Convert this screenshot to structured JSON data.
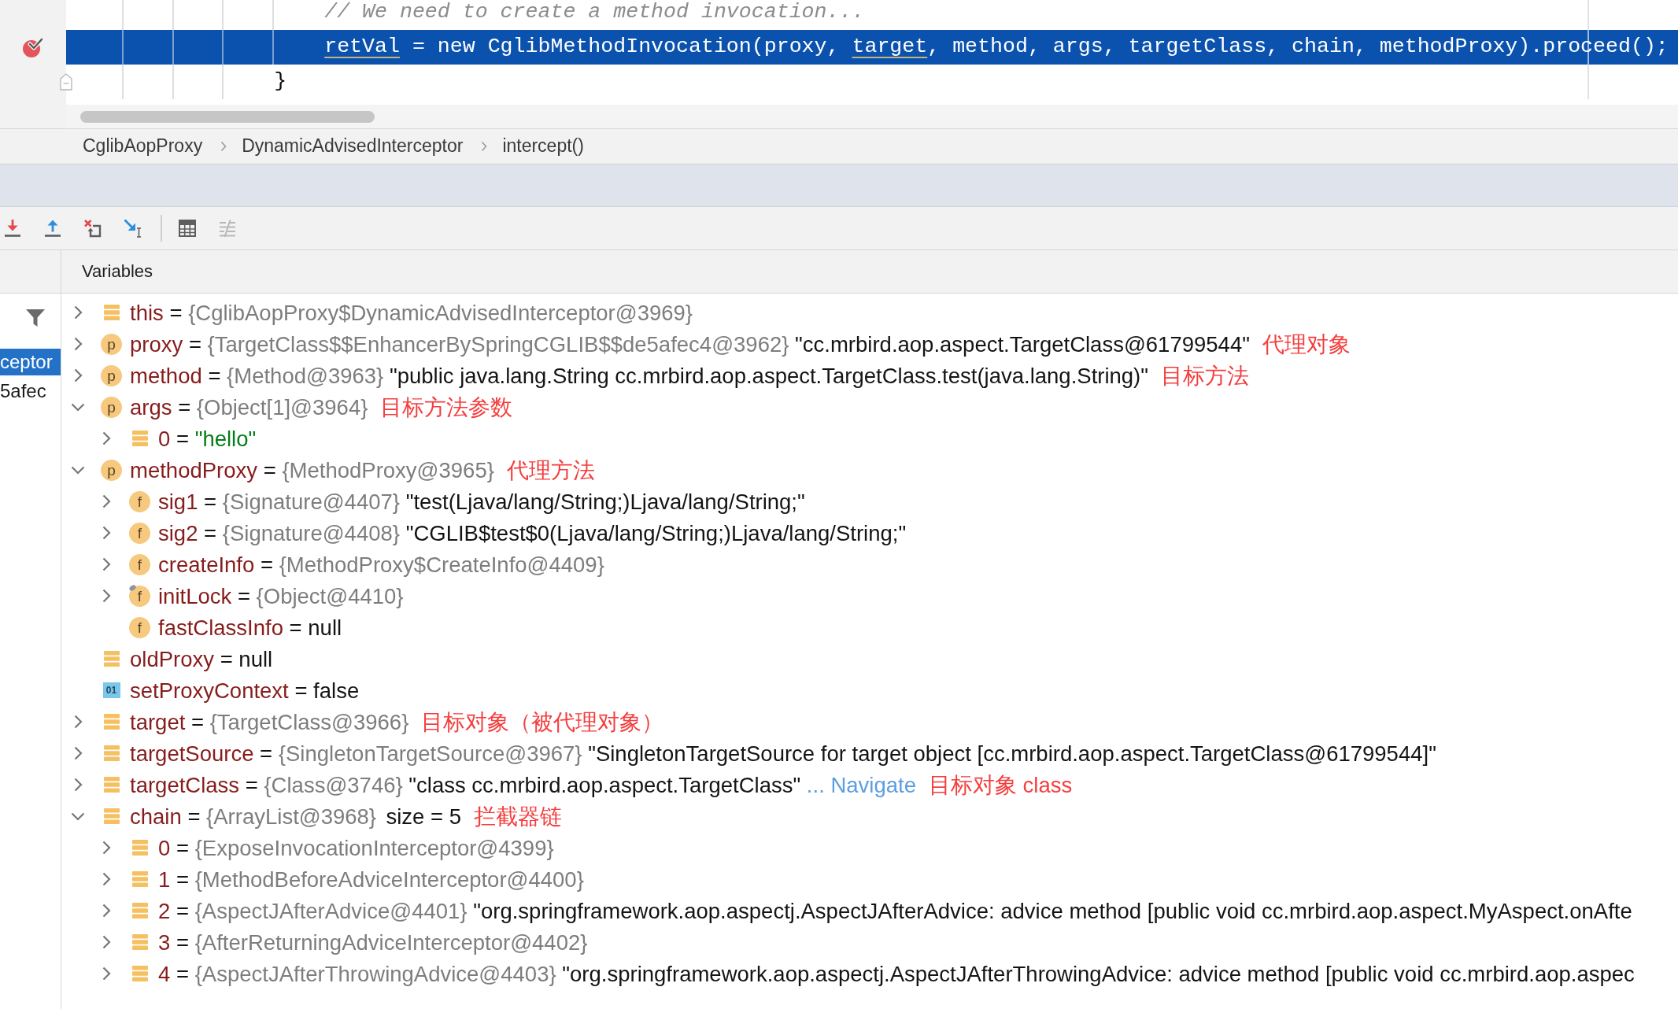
{
  "editor": {
    "lines": [
      {
        "kind": "comment",
        "highlighted": false,
        "breakpoint": false,
        "fold": false,
        "tokens": [
          {
            "text": "                    // We need to create a method invocation...",
            "underlined": false
          }
        ]
      },
      {
        "kind": "code",
        "highlighted": true,
        "breakpoint": true,
        "fold": false,
        "tokens": [
          {
            "text": "                    retVal",
            "underlined": true
          },
          {
            "text": " = new CglibMethodInvocation(proxy, ",
            "underlined": false
          },
          {
            "text": "target",
            "underlined": true
          },
          {
            "text": ", method, args, targetClass, chain, methodProxy).proceed();",
            "underlined": false
          }
        ]
      },
      {
        "kind": "code",
        "highlighted": false,
        "breakpoint": false,
        "fold": true,
        "tokens": [
          {
            "text": "                }",
            "underlined": false
          }
        ]
      }
    ]
  },
  "breadcrumbs": [
    "CglibAopProxy",
    "DynamicAdvisedInterceptor",
    "intercept()"
  ],
  "toolbar": [
    {
      "kind": "down",
      "disabled": false
    },
    {
      "kind": "up",
      "disabled": false
    },
    {
      "kind": "drop",
      "disabled": false
    },
    {
      "kind": "cursor",
      "disabled": false
    },
    {
      "kind": "separator"
    },
    {
      "kind": "table",
      "disabled": false
    },
    {
      "kind": "trace",
      "disabled": true
    }
  ],
  "frames": [
    {
      "text": "ceptor",
      "selected": true
    },
    {
      "text": "5afec",
      "selected": false
    }
  ],
  "variables": {
    "title": "Variables",
    "nodes": [
      {
        "kind": "list",
        "expandable": true,
        "expanded": false,
        "name": "this",
        "op": "=",
        "type": "{CglibAopProxy$DynamicAdvisedInterceptor@3969}"
      },
      {
        "kind": "param",
        "icon_text": "p",
        "expandable": true,
        "expanded": false,
        "name": "proxy",
        "op": "=",
        "type": "{TargetClass$$EnhancerBySpringCGLIB$$de5afec4@3962}",
        "value": "\"cc.mrbird.aop.aspect.TargetClass@61799544\"",
        "literal": false,
        "note": "代理对象"
      },
      {
        "kind": "param",
        "icon_text": "p",
        "expandable": true,
        "expanded": false,
        "name": "method",
        "op": "=",
        "type": "{Method@3963}",
        "value": "\"public java.lang.String cc.mrbird.aop.aspect.TargetClass.test(java.lang.String)\"",
        "literal": false,
        "note": "目标方法"
      },
      {
        "kind": "param",
        "icon_text": "p",
        "expandable": true,
        "expanded": true,
        "name": "args",
        "op": "=",
        "type": "{Object[1]@3964}",
        "note": "目标方法参数",
        "children": [
          {
            "kind": "list",
            "expandable": true,
            "expanded": false,
            "name": "0",
            "op": "=",
            "value": "\"hello\"",
            "literal": true
          }
        ]
      },
      {
        "kind": "param",
        "icon_text": "p",
        "expandable": true,
        "expanded": true,
        "name": "methodProxy",
        "op": "=",
        "type": "{MethodProxy@3965}",
        "note": "代理方法",
        "children": [
          {
            "kind": "field",
            "icon_text": "f",
            "expandable": true,
            "expanded": false,
            "name": "sig1",
            "op": "=",
            "type": "{Signature@4407}",
            "value": "\"test(Ljava/lang/String;)Ljava/lang/String;\"",
            "literal": false
          },
          {
            "kind": "field",
            "icon_text": "f",
            "expandable": true,
            "expanded": false,
            "name": "sig2",
            "op": "=",
            "type": "{Signature@4408}",
            "value": "\"CGLIB$test$0(Ljava/lang/String;)Ljava/lang/String;\"",
            "literal": false
          },
          {
            "kind": "field",
            "icon_text": "f",
            "expandable": true,
            "expanded": false,
            "name": "createInfo",
            "op": "=",
            "type": "{MethodProxy$CreateInfo@4409}"
          },
          {
            "kind": "field_tagged",
            "icon_text": "f",
            "expandable": true,
            "expanded": false,
            "name": "initLock",
            "op": "=",
            "type": "{Object@4410}"
          },
          {
            "kind": "field",
            "icon_text": "f",
            "expandable": false,
            "expanded": false,
            "name": "fastClassInfo",
            "op": "=",
            "value": "null",
            "literal": false
          }
        ]
      },
      {
        "kind": "list",
        "expandable": false,
        "expanded": false,
        "name": "oldProxy",
        "op": "=",
        "value": "null",
        "literal": false
      },
      {
        "kind": "bool",
        "icon_text": "01",
        "expandable": false,
        "expanded": false,
        "name": "setProxyContext",
        "op": "=",
        "value": "false",
        "literal": false
      },
      {
        "kind": "list",
        "expandable": true,
        "expanded": false,
        "name": "target",
        "op": "=",
        "type": "{TargetClass@3966}",
        "note": "目标对象（被代理对象）"
      },
      {
        "kind": "list",
        "expandable": true,
        "expanded": false,
        "name": "targetSource",
        "op": "=",
        "type": "{SingletonTargetSource@3967}",
        "value": "\"SingletonTargetSource for target object [cc.mrbird.aop.aspect.TargetClass@61799544]\"",
        "literal": false
      },
      {
        "kind": "list",
        "expandable": true,
        "expanded": false,
        "name": "targetClass",
        "op": "=",
        "type": "{Class@3746}",
        "value": "\"class cc.mrbird.aop.aspect.TargetClass\"",
        "literal": false,
        "link": "... Navigate",
        "note": "目标对象 class"
      },
      {
        "kind": "list",
        "expandable": true,
        "expanded": true,
        "name": "chain",
        "op": "=",
        "type": "{ArrayList@3968}",
        "extra": "size = 5",
        "note": "拦截器链",
        "children": [
          {
            "kind": "list",
            "expandable": true,
            "expanded": false,
            "name": "0",
            "op": "=",
            "type": "{ExposeInvocationInterceptor@4399}"
          },
          {
            "kind": "list",
            "expandable": true,
            "expanded": false,
            "name": "1",
            "op": "=",
            "type": "{MethodBeforeAdviceInterceptor@4400}"
          },
          {
            "kind": "list",
            "expandable": true,
            "expanded": false,
            "name": "2",
            "op": "=",
            "type": "{AspectJAfterAdvice@4401}",
            "value": "\"org.springframework.aop.aspectj.AspectJAfterAdvice: advice method [public void cc.mrbird.aop.aspect.MyAspect.onAfte",
            "literal": false
          },
          {
            "kind": "list",
            "expandable": true,
            "expanded": false,
            "name": "3",
            "op": "=",
            "type": "{AfterReturningAdviceInterceptor@4402}"
          },
          {
            "kind": "list",
            "expandable": true,
            "expanded": false,
            "name": "4",
            "op": "=",
            "type": "{AspectJAfterThrowingAdvice@4403}",
            "value": "\"org.springframework.aop.aspectj.AspectJAfterThrowingAdvice: advice method [public void cc.mrbird.aop.aspec",
            "literal": false
          }
        ]
      }
    ]
  }
}
